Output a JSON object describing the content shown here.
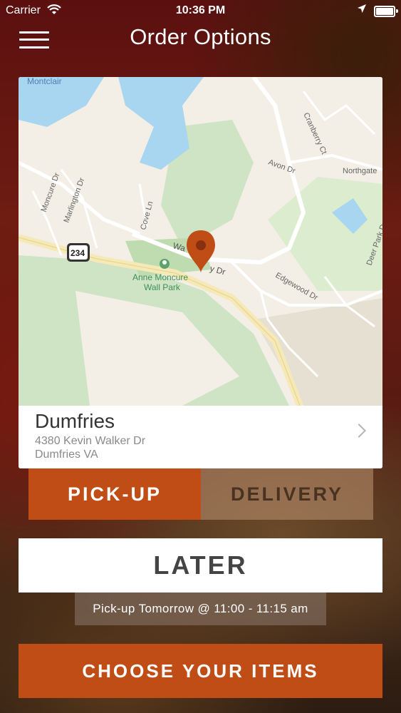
{
  "status_bar": {
    "carrier": "Carrier",
    "time": "10:36 PM"
  },
  "header": {
    "title": "Order Options",
    "menu_icon": "hamburger-menu-icon"
  },
  "map": {
    "labels": {
      "montclair": "Montclair",
      "moncure_dr": "Moncure Dr",
      "marlington_dr": "Marlington Dr",
      "cove_ln": "Cove Ln",
      "avon_dr": "Avon Dr",
      "cranberry_ct": "Cranberry Ct",
      "northgate": "Northgate",
      "deer_park_dr": "Deer Park Dr",
      "waverly_dr": "Wa",
      "waverly_dr2": "y Dr",
      "edgewood_dr": "Edgewood Dr",
      "park_line1": "Anne Moncure",
      "park_line2": "Wall Park",
      "route": "234"
    },
    "pin_color": "#c14d16"
  },
  "store": {
    "name": "Dumfries",
    "address_line1": "4380 Kevin Walker Dr",
    "address_line2": "Dumfries VA"
  },
  "order_type": {
    "pickup_label": "PICK-UP",
    "delivery_label": "DELIVERY",
    "selected": "pickup"
  },
  "timing": {
    "later_label": "LATER",
    "pickup_time": "Pick-up Tomorrow @ 11:00 - 11:15 am"
  },
  "cta": {
    "choose_items_label": "CHOOSE YOUR ITEMS"
  },
  "colors": {
    "accent": "#c14d16"
  }
}
